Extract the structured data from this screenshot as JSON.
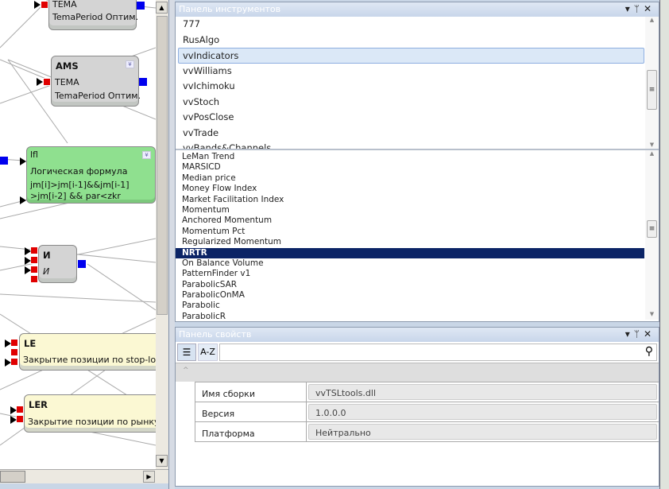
{
  "canvas": {
    "nodes": [
      {
        "title": "",
        "lines": [
          "TEMA",
          "TemaPeriod Оптим."
        ]
      },
      {
        "title": "AMS",
        "lines": [
          "TEMA",
          "TemaPeriod Оптим."
        ]
      },
      {
        "title": "lfl",
        "lines": [
          "Логическая формула",
          "jm[i]>jm[i-1]&&jm[i-1]",
          ">jm[i-2] && par<zkr"
        ]
      },
      {
        "title": "И",
        "lines": [
          "И"
        ]
      },
      {
        "title": "LE",
        "lines": [
          "Закрытие позиции по stop-los"
        ]
      },
      {
        "title": "LER",
        "lines": [
          "Закрытие позиции по рынку"
        ]
      }
    ]
  },
  "toolbox": {
    "title": "Панель инструментов",
    "groups": [
      "777",
      "RusAlgo",
      "vvIndicators",
      "vvWilliams",
      "vvIchimoku",
      "vvStoch",
      "vvPosClose",
      "vvTrade",
      "vvBands&Channels"
    ],
    "items": [
      "LeMan Trend",
      "MARSICD",
      "Median price",
      "Money Flow Index",
      "Market Facilitation Index",
      "Momentum",
      "Anchored Momentum",
      "Momentum Pct",
      "Regularized Momentum",
      "NRTR",
      "On Balance Volume",
      "PatternFinder v1",
      "ParabolicSAR",
      "ParabolicOnMA",
      "Parabolic",
      "ParabolicR"
    ]
  },
  "props": {
    "title": "Панель свойств",
    "sort_az": "A-Z",
    "search_placeholder": "",
    "rows": [
      {
        "name": "Имя сборки",
        "value": "vvTSLtools.dll"
      },
      {
        "name": "Версия",
        "value": "1.0.0.0"
      },
      {
        "name": "Платформа",
        "value": "Нейтрально"
      }
    ]
  },
  "colors": {
    "selected": "#0b2466",
    "input_pin": "#e00000",
    "output_pin": "#0000ee"
  }
}
